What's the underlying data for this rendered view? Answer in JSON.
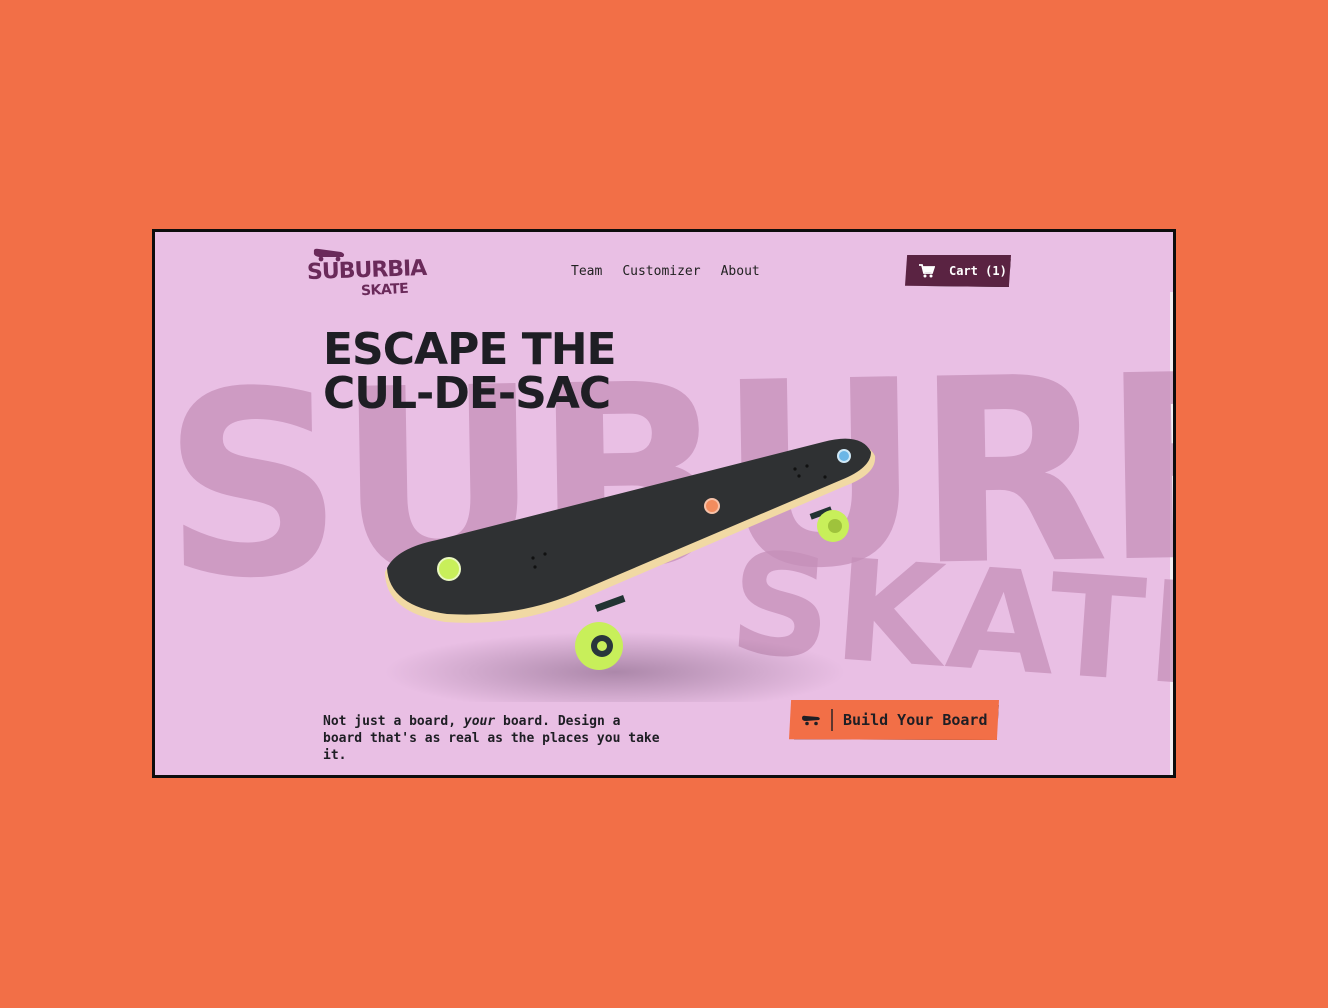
{
  "brand": {
    "line1": "SUBURBIA",
    "line2": "SKATE"
  },
  "background_word": {
    "line1": "SUBURBIA",
    "line2": "SKATE"
  },
  "nav": {
    "items": [
      "Team",
      "Customizer",
      "About"
    ]
  },
  "cart": {
    "label": "Cart (1)",
    "icon": "cart-icon"
  },
  "hero": {
    "headline_line1": "ESCAPE THE",
    "headline_line2": "CUL-DE-SAC",
    "tagline_prefix": "Not just a board, ",
    "tagline_emphasis": "your",
    "tagline_suffix": " board. Design a board that's as real as the places you take it.",
    "cta_label": "Build Your Board",
    "cta_icon": "skateboard-icon"
  },
  "colors": {
    "page_bg": "#F26F47",
    "hero_bg": "#E9BFE4",
    "accent_purple": "#5a2342",
    "wheel": "#c8ef5a",
    "hotspots": [
      "#c8ef5a",
      "#F28C5E",
      "#6cb6e6"
    ]
  }
}
